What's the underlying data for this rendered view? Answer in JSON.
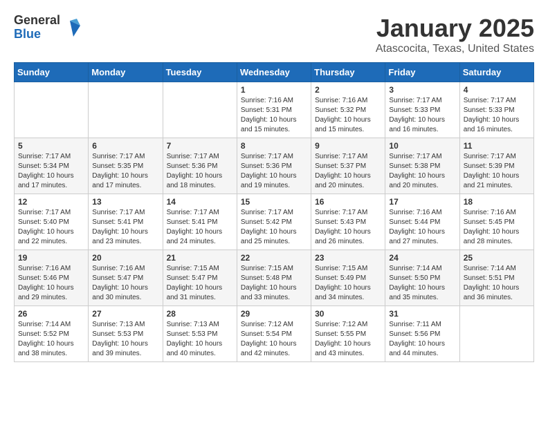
{
  "logo": {
    "general": "General",
    "blue": "Blue"
  },
  "title": "January 2025",
  "subtitle": "Atascocita, Texas, United States",
  "days_of_week": [
    "Sunday",
    "Monday",
    "Tuesday",
    "Wednesday",
    "Thursday",
    "Friday",
    "Saturday"
  ],
  "weeks": [
    [
      {
        "day": "",
        "info": ""
      },
      {
        "day": "",
        "info": ""
      },
      {
        "day": "",
        "info": ""
      },
      {
        "day": "1",
        "info": "Sunrise: 7:16 AM\nSunset: 5:31 PM\nDaylight: 10 hours\nand 15 minutes."
      },
      {
        "day": "2",
        "info": "Sunrise: 7:16 AM\nSunset: 5:32 PM\nDaylight: 10 hours\nand 15 minutes."
      },
      {
        "day": "3",
        "info": "Sunrise: 7:17 AM\nSunset: 5:33 PM\nDaylight: 10 hours\nand 16 minutes."
      },
      {
        "day": "4",
        "info": "Sunrise: 7:17 AM\nSunset: 5:33 PM\nDaylight: 10 hours\nand 16 minutes."
      }
    ],
    [
      {
        "day": "5",
        "info": "Sunrise: 7:17 AM\nSunset: 5:34 PM\nDaylight: 10 hours\nand 17 minutes."
      },
      {
        "day": "6",
        "info": "Sunrise: 7:17 AM\nSunset: 5:35 PM\nDaylight: 10 hours\nand 17 minutes."
      },
      {
        "day": "7",
        "info": "Sunrise: 7:17 AM\nSunset: 5:36 PM\nDaylight: 10 hours\nand 18 minutes."
      },
      {
        "day": "8",
        "info": "Sunrise: 7:17 AM\nSunset: 5:36 PM\nDaylight: 10 hours\nand 19 minutes."
      },
      {
        "day": "9",
        "info": "Sunrise: 7:17 AM\nSunset: 5:37 PM\nDaylight: 10 hours\nand 20 minutes."
      },
      {
        "day": "10",
        "info": "Sunrise: 7:17 AM\nSunset: 5:38 PM\nDaylight: 10 hours\nand 20 minutes."
      },
      {
        "day": "11",
        "info": "Sunrise: 7:17 AM\nSunset: 5:39 PM\nDaylight: 10 hours\nand 21 minutes."
      }
    ],
    [
      {
        "day": "12",
        "info": "Sunrise: 7:17 AM\nSunset: 5:40 PM\nDaylight: 10 hours\nand 22 minutes."
      },
      {
        "day": "13",
        "info": "Sunrise: 7:17 AM\nSunset: 5:41 PM\nDaylight: 10 hours\nand 23 minutes."
      },
      {
        "day": "14",
        "info": "Sunrise: 7:17 AM\nSunset: 5:41 PM\nDaylight: 10 hours\nand 24 minutes."
      },
      {
        "day": "15",
        "info": "Sunrise: 7:17 AM\nSunset: 5:42 PM\nDaylight: 10 hours\nand 25 minutes."
      },
      {
        "day": "16",
        "info": "Sunrise: 7:17 AM\nSunset: 5:43 PM\nDaylight: 10 hours\nand 26 minutes."
      },
      {
        "day": "17",
        "info": "Sunrise: 7:16 AM\nSunset: 5:44 PM\nDaylight: 10 hours\nand 27 minutes."
      },
      {
        "day": "18",
        "info": "Sunrise: 7:16 AM\nSunset: 5:45 PM\nDaylight: 10 hours\nand 28 minutes."
      }
    ],
    [
      {
        "day": "19",
        "info": "Sunrise: 7:16 AM\nSunset: 5:46 PM\nDaylight: 10 hours\nand 29 minutes."
      },
      {
        "day": "20",
        "info": "Sunrise: 7:16 AM\nSunset: 5:47 PM\nDaylight: 10 hours\nand 30 minutes."
      },
      {
        "day": "21",
        "info": "Sunrise: 7:15 AM\nSunset: 5:47 PM\nDaylight: 10 hours\nand 31 minutes."
      },
      {
        "day": "22",
        "info": "Sunrise: 7:15 AM\nSunset: 5:48 PM\nDaylight: 10 hours\nand 33 minutes."
      },
      {
        "day": "23",
        "info": "Sunrise: 7:15 AM\nSunset: 5:49 PM\nDaylight: 10 hours\nand 34 minutes."
      },
      {
        "day": "24",
        "info": "Sunrise: 7:14 AM\nSunset: 5:50 PM\nDaylight: 10 hours\nand 35 minutes."
      },
      {
        "day": "25",
        "info": "Sunrise: 7:14 AM\nSunset: 5:51 PM\nDaylight: 10 hours\nand 36 minutes."
      }
    ],
    [
      {
        "day": "26",
        "info": "Sunrise: 7:14 AM\nSunset: 5:52 PM\nDaylight: 10 hours\nand 38 minutes."
      },
      {
        "day": "27",
        "info": "Sunrise: 7:13 AM\nSunset: 5:53 PM\nDaylight: 10 hours\nand 39 minutes."
      },
      {
        "day": "28",
        "info": "Sunrise: 7:13 AM\nSunset: 5:53 PM\nDaylight: 10 hours\nand 40 minutes."
      },
      {
        "day": "29",
        "info": "Sunrise: 7:12 AM\nSunset: 5:54 PM\nDaylight: 10 hours\nand 42 minutes."
      },
      {
        "day": "30",
        "info": "Sunrise: 7:12 AM\nSunset: 5:55 PM\nDaylight: 10 hours\nand 43 minutes."
      },
      {
        "day": "31",
        "info": "Sunrise: 7:11 AM\nSunset: 5:56 PM\nDaylight: 10 hours\nand 44 minutes."
      },
      {
        "day": "",
        "info": ""
      }
    ]
  ]
}
